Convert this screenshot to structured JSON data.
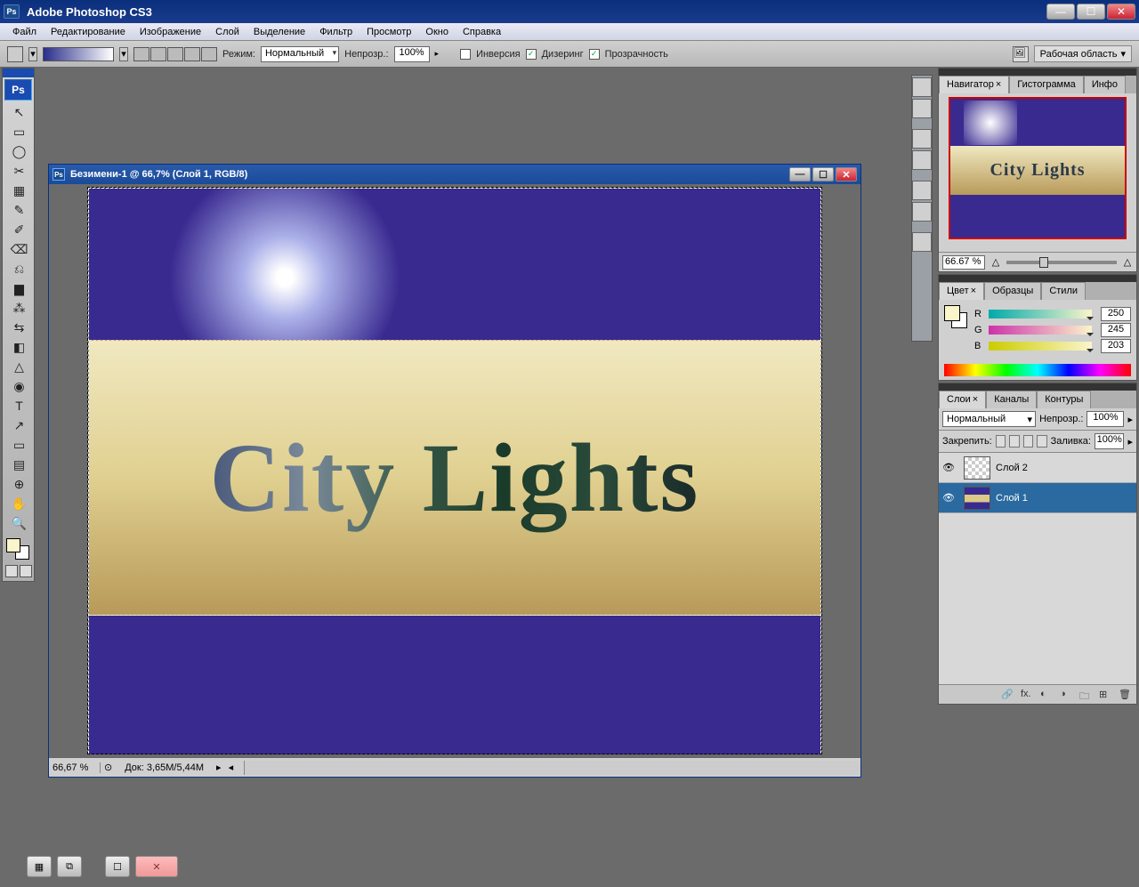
{
  "app": {
    "title": "Adobe Photoshop CS3",
    "ps_icon": "Ps"
  },
  "window_buttons": {
    "min": "—",
    "max": "☐",
    "close": "✕"
  },
  "menu": [
    "Файл",
    "Редактирование",
    "Изображение",
    "Слой",
    "Выделение",
    "Фильтр",
    "Просмотр",
    "Окно",
    "Справка"
  ],
  "optbar": {
    "mode_label": "Режим:",
    "mode_value": "Нормальный",
    "opacity_label": "Непрозр.:",
    "opacity_value": "100%",
    "inversion": "Инверсия",
    "dither": "Дизеринг",
    "transparency": "Прозрачность",
    "workspace": "Рабочая область"
  },
  "doc": {
    "title": "Безимени-1 @ 66,7% (Слой 1, RGB/8)",
    "text": "City Lights",
    "zoom": "66,67 %",
    "docinfo": "Док: 3,65M/5,44M"
  },
  "navigator": {
    "tabs": [
      "Навигатор",
      "Гистограмма",
      "Инфо"
    ],
    "zoom": "66.67 %",
    "thumb_text": "City Lights"
  },
  "color": {
    "tabs": [
      "Цвет",
      "Образцы",
      "Стили"
    ],
    "r_label": "R",
    "g_label": "G",
    "b_label": "B",
    "r": "250",
    "g": "245",
    "b": "203"
  },
  "layers": {
    "tabs": [
      "Слои",
      "Каналы",
      "Контуры"
    ],
    "blend": "Нормальный",
    "opacity_label": "Непрозр.:",
    "opacity": "100%",
    "lock_label": "Закрепить:",
    "fill_label": "Заливка:",
    "fill": "100%",
    "items": [
      {
        "name": "Слой 2"
      },
      {
        "name": "Слой 1"
      }
    ]
  },
  "tools": [
    "↖",
    "▭",
    "◯",
    "✂",
    "▦",
    "✎",
    "✐",
    "⌫",
    "⎌",
    "▆",
    "⁂",
    "⇆",
    "◧",
    "△",
    "◉",
    "T",
    "↗",
    "▭",
    "▤",
    "⊕",
    "✋",
    "🔍"
  ]
}
